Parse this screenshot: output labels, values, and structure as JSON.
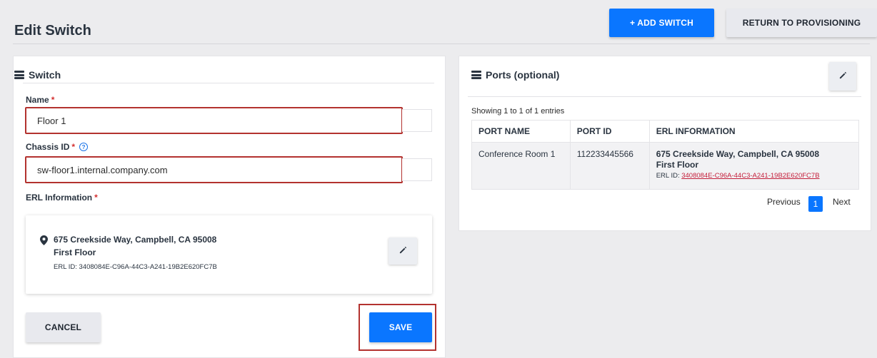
{
  "header": {
    "title": "Edit Switch",
    "add_switch_label": "+ ADD SWITCH",
    "return_label": "RETURN TO PROVISIONING"
  },
  "switch_section": {
    "title": "Switch",
    "name_label": "Name",
    "name_value": "Floor 1",
    "chassis_label": "Chassis ID",
    "chassis_value": "sw-floor1.internal.company.com",
    "erl_label": "ERL Information",
    "required_mark": "*",
    "help_glyph": "?",
    "erl": {
      "address": "675 Creekside Way, Campbell, CA 95008",
      "floor": "First Floor",
      "id_line": "ERL ID: 3408084E-C96A-44C3-A241-19B2E620FC7B"
    },
    "cancel_label": "CANCEL",
    "save_label": "SAVE"
  },
  "ports_section": {
    "title": "Ports (optional)",
    "showing_text": "Showing 1 to 1 of 1 entries",
    "columns": [
      "PORT NAME",
      "PORT ID",
      "ERL INFORMATION"
    ],
    "rows": [
      {
        "port_name": "Conference Room 1",
        "port_id": "112233445566",
        "erl_address": "675 Creekside Way, Campbell, CA 95008",
        "erl_floor": "First Floor",
        "erl_id_prefix": "ERL ID: ",
        "erl_id": "3408084E-C96A-44C3-A241-19B2E620FC7B"
      }
    ],
    "pagination": {
      "previous": "Previous",
      "current_page": "1",
      "next": "Next"
    }
  },
  "colors": {
    "primary": "#0a76ff",
    "highlight_outline": "#b3322f",
    "required": "#d32f2f",
    "erl_link": "#c41e3a"
  },
  "icons": {
    "section_icon": "list-icon",
    "location": "map-pin-icon",
    "edit": "pencil-icon",
    "help": "help-circle-icon"
  }
}
